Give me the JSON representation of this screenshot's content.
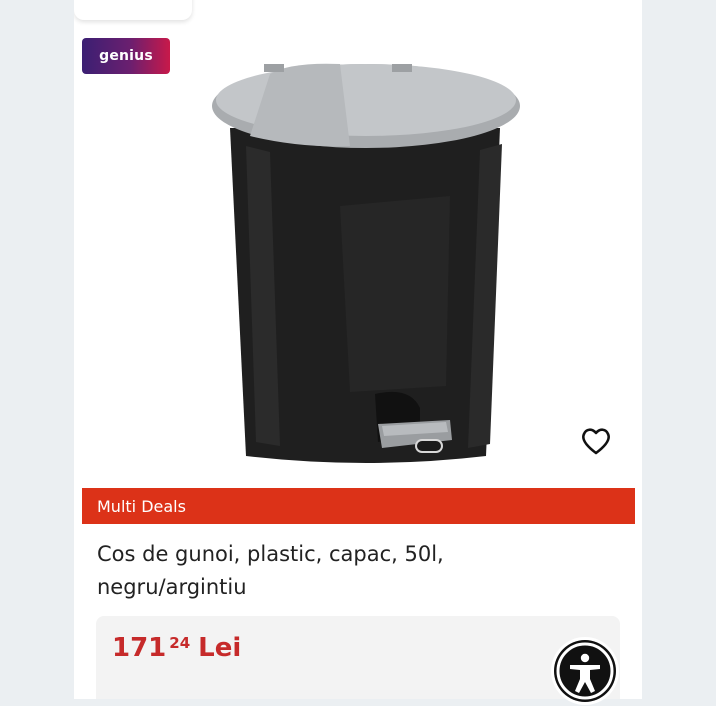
{
  "badge": {
    "label": "genius"
  },
  "product": {
    "image": "black-silver-pedal-trash-bin",
    "favorite_icon": "heart-outline-icon",
    "promo_label": "Multi Deals",
    "title_line1": "Cos de gunoi, plastic, capac, 50l,",
    "title_line2": "negru/argintiu",
    "price": {
      "integer": "171",
      "decimals": "24",
      "currency": "Lei"
    }
  },
  "accessibility": {
    "icon": "accessibility-icon"
  },
  "colors": {
    "promo": "#dc3218",
    "price": "#c62a2a"
  }
}
